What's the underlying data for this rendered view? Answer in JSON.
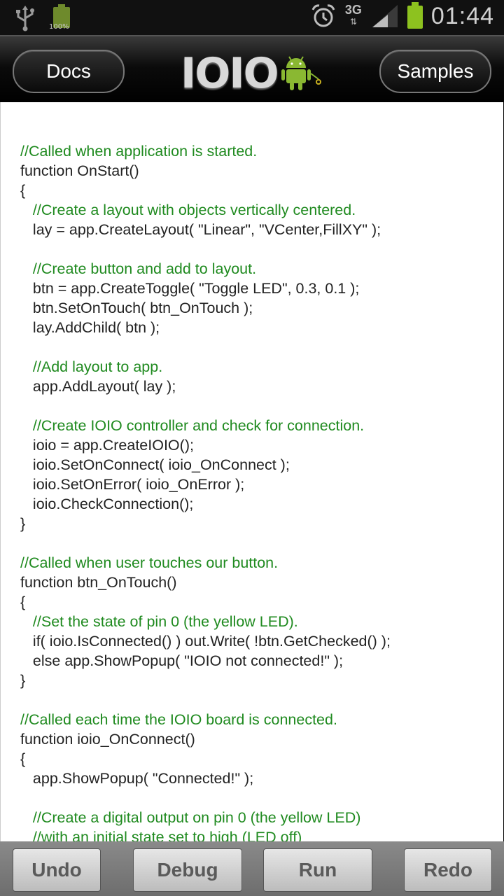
{
  "status": {
    "battery_small_label": "100%",
    "network": "3G",
    "time": "01:44"
  },
  "header": {
    "docs_label": "Docs",
    "logo_text": "IOIO",
    "samples_label": "Samples"
  },
  "code_lines": [
    {
      "text": "//Called when application is started.",
      "comment": true
    },
    {
      "text": "function OnStart()",
      "comment": false
    },
    {
      "text": "{",
      "comment": false
    },
    {
      "text": "   //Create a layout with objects vertically centered.",
      "comment": true
    },
    {
      "text": "   lay = app.CreateLayout( \"Linear\", \"VCenter,FillXY\" );",
      "comment": false
    },
    {
      "text": "",
      "comment": false
    },
    {
      "text": "   //Create button and add to layout.",
      "comment": true
    },
    {
      "text": "   btn = app.CreateToggle( \"Toggle LED\", 0.3, 0.1 );",
      "comment": false
    },
    {
      "text": "   btn.SetOnTouch( btn_OnTouch );",
      "comment": false
    },
    {
      "text": "   lay.AddChild( btn );",
      "comment": false
    },
    {
      "text": "",
      "comment": false
    },
    {
      "text": "   //Add layout to app.",
      "comment": true
    },
    {
      "text": "   app.AddLayout( lay );",
      "comment": false
    },
    {
      "text": "",
      "comment": false
    },
    {
      "text": "   //Create IOIO controller and check for connection.",
      "comment": true
    },
    {
      "text": "   ioio = app.CreateIOIO();",
      "comment": false
    },
    {
      "text": "   ioio.SetOnConnect( ioio_OnConnect );",
      "comment": false
    },
    {
      "text": "   ioio.SetOnError( ioio_OnError );",
      "comment": false
    },
    {
      "text": "   ioio.CheckConnection();",
      "comment": false
    },
    {
      "text": "}",
      "comment": false
    },
    {
      "text": "",
      "comment": false
    },
    {
      "text": "//Called when user touches our button.",
      "comment": true
    },
    {
      "text": "function btn_OnTouch()",
      "comment": false
    },
    {
      "text": "{",
      "comment": false
    },
    {
      "text": "   //Set the state of pin 0 (the yellow LED).",
      "comment": true
    },
    {
      "text": "   if( ioio.IsConnected() ) out.Write( !btn.GetChecked() );",
      "comment": false
    },
    {
      "text": "   else app.ShowPopup( \"IOIO not connected!\" );",
      "comment": false
    },
    {
      "text": "}",
      "comment": false
    },
    {
      "text": "",
      "comment": false
    },
    {
      "text": "//Called each time the IOIO board is connected.",
      "comment": true
    },
    {
      "text": "function ioio_OnConnect()",
      "comment": false
    },
    {
      "text": "{",
      "comment": false
    },
    {
      "text": "   app.ShowPopup( \"Connected!\" );",
      "comment": false
    },
    {
      "text": "",
      "comment": false
    },
    {
      "text": "   //Create a digital output on pin 0 (the yellow LED)",
      "comment": true
    },
    {
      "text": "   //with an initial state set to high (LED off)",
      "comment": true
    }
  ],
  "toolbar": {
    "undo_label": "Undo",
    "debug_label": "Debug",
    "run_label": "Run",
    "redo_label": "Redo"
  },
  "colors": {
    "comment": "#1f8a1f",
    "code": "#222222",
    "battery": "#8dc21f"
  }
}
